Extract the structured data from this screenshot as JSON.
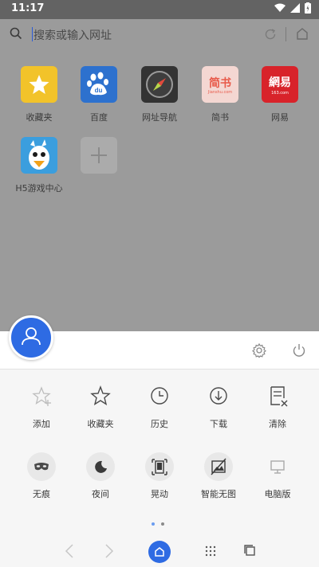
{
  "status": {
    "time": "11:17"
  },
  "search": {
    "placeholder": "搜索或输入网址"
  },
  "tiles": [
    {
      "label": "收藏夹",
      "icon": "star-icon",
      "color": "#f2c32a"
    },
    {
      "label": "百度",
      "icon": "baidu-paw-icon",
      "color": "#2d71ce"
    },
    {
      "label": "网址导航",
      "icon": "compass-icon",
      "color": "#333333"
    },
    {
      "label": "简书",
      "icon": "jianshu-logo",
      "color": "#f4d7d2",
      "logo_text": "简书",
      "logo_sub": "Jianshu.com"
    },
    {
      "label": "网易",
      "icon": "netease-logo",
      "color": "#d8232a",
      "logo_text": "網易",
      "logo_sub": "163.com"
    },
    {
      "label": "H5游戏中心",
      "icon": "bird-icon",
      "color": "#3b9ede"
    },
    {
      "label": "",
      "icon": "add-icon",
      "color": "#ababab"
    }
  ],
  "menu": {
    "row1": [
      {
        "label": "添加",
        "icon": "star-plus-icon"
      },
      {
        "label": "收藏夹",
        "icon": "star-outline-icon"
      },
      {
        "label": "历史",
        "icon": "clock-icon"
      },
      {
        "label": "下载",
        "icon": "download-icon"
      },
      {
        "label": "清除",
        "icon": "clear-icon"
      }
    ],
    "row2": [
      {
        "label": "无痕",
        "icon": "mask-icon"
      },
      {
        "label": "夜间",
        "icon": "moon-icon"
      },
      {
        "label": "晃动",
        "icon": "shake-icon"
      },
      {
        "label": "智能无图",
        "icon": "no-image-icon"
      },
      {
        "label": "电脑版",
        "icon": "desktop-icon"
      }
    ]
  },
  "pager": {
    "pages": 2,
    "current": 1
  },
  "colors": {
    "accent": "#2e6be3",
    "overlay": "#9b9b9b",
    "sheet": "#f6f6f6"
  }
}
